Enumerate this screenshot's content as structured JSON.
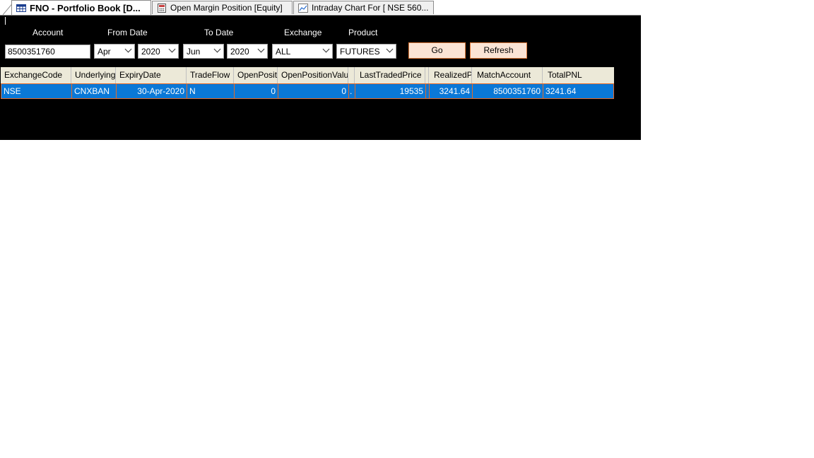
{
  "tabs": [
    {
      "label": "FNO - Portfolio Book [D...",
      "icon": "grid-book-icon",
      "active": true
    },
    {
      "label": "Open Margin Position [Equity]",
      "icon": "calculator-icon",
      "active": false
    },
    {
      "label": "Intraday Chart For [ NSE 560...",
      "icon": "line-chart-icon",
      "active": false
    }
  ],
  "filters": {
    "account_label": "Account",
    "account_value": "8500351760",
    "from_date_label": "From Date",
    "from_month": "Apr",
    "from_year": "2020",
    "to_date_label": "To Date",
    "to_month": "Jun",
    "to_year": "2020",
    "exchange_label": "Exchange",
    "exchange_value": "ALL",
    "product_label": "Product",
    "product_value": "FUTURES",
    "go_label": "Go",
    "refresh_label": "Refresh"
  },
  "grid": {
    "columns": [
      "ExchangeCode",
      "Underlying",
      "ExpiryDate",
      "TradeFlow",
      "OpenPositio",
      "OpenPositionValue",
      "",
      "LastTradedPrice",
      "",
      "RealizedPr",
      "MatchAccount",
      "TotalPNL"
    ],
    "rows": [
      [
        "NSE",
        "CNXBAN",
        "30-Apr-2020",
        "N",
        "0",
        "0",
        ".",
        "19535",
        "",
        "3241.64",
        "8500351760",
        "3241.64"
      ]
    ]
  },
  "colors": {
    "panel_bg": "#000000",
    "selected_row": "#0a78d7",
    "row_border": "#e36a2a",
    "button_bg": "#fbe4d5",
    "button_border": "#e07a3a",
    "header_bg": "#ece9d8"
  }
}
